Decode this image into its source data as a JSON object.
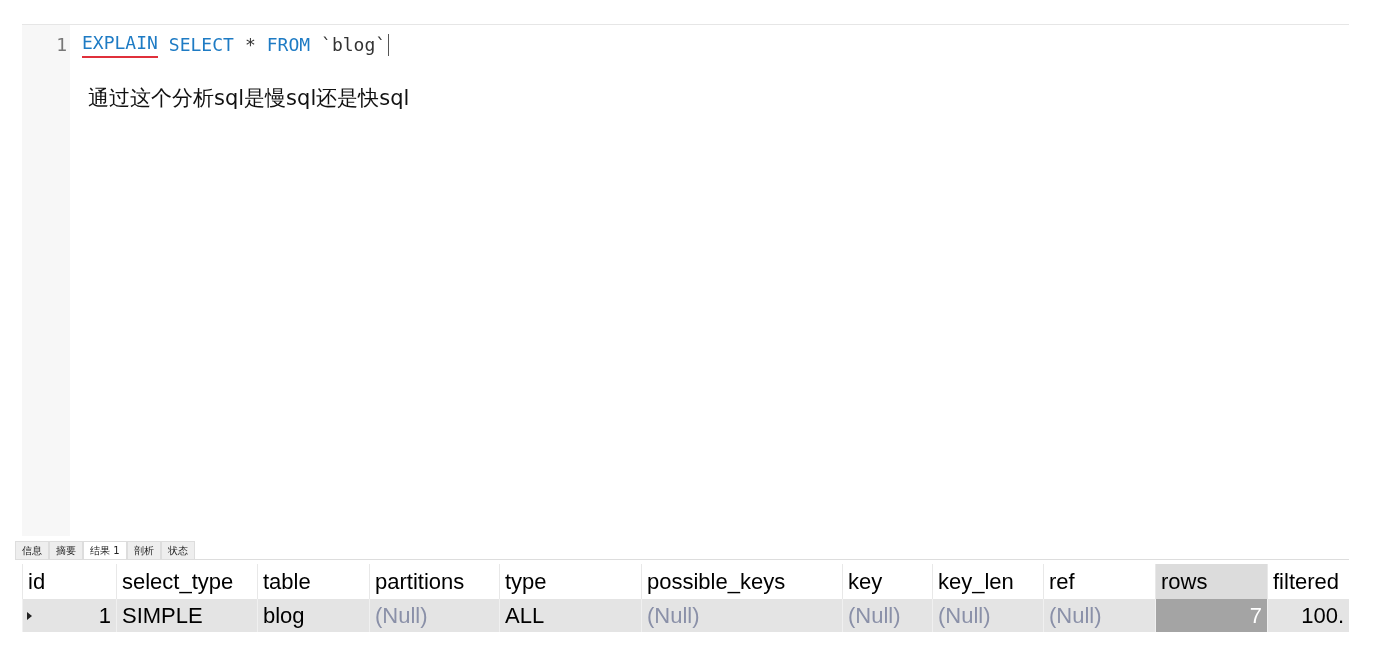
{
  "editor": {
    "lines": [
      {
        "number": "1",
        "tokens": [
          {
            "text": "EXPLAIN",
            "kind": "keyword",
            "underlined": true
          },
          {
            "text": "SELECT",
            "kind": "keyword",
            "underlined": false
          },
          {
            "text": "*",
            "kind": "plain",
            "underlined": false
          },
          {
            "text": "FROM",
            "kind": "keyword",
            "underlined": false
          },
          {
            "text": "`blog`",
            "kind": "plain",
            "underlined": false
          }
        ]
      }
    ],
    "annotation": "通过这个分析sql是慢sql还是快sql"
  },
  "tabs": [
    {
      "label": "信息",
      "selected": false
    },
    {
      "label": "摘要",
      "selected": false
    },
    {
      "label": "结果 1",
      "selected": true
    },
    {
      "label": "剖析",
      "selected": false
    },
    {
      "label": "状态",
      "selected": false
    }
  ],
  "table": {
    "columns": [
      {
        "label": "id",
        "selected": false
      },
      {
        "label": "select_type",
        "selected": false
      },
      {
        "label": "table",
        "selected": false
      },
      {
        "label": "partitions",
        "selected": false
      },
      {
        "label": "type",
        "selected": false
      },
      {
        "label": "possible_keys",
        "selected": false
      },
      {
        "label": "key",
        "selected": false
      },
      {
        "label": "key_len",
        "selected": false
      },
      {
        "label": "ref",
        "selected": false
      },
      {
        "label": "rows",
        "selected": true
      },
      {
        "label": "filtered",
        "selected": false
      }
    ],
    "rows": [
      {
        "current": true,
        "cells": [
          {
            "text": "1",
            "kind": "number"
          },
          {
            "text": "SIMPLE",
            "kind": "text"
          },
          {
            "text": "blog",
            "kind": "text"
          },
          {
            "text": "(Null)",
            "kind": "null"
          },
          {
            "text": "ALL",
            "kind": "text"
          },
          {
            "text": "(Null)",
            "kind": "null"
          },
          {
            "text": "(Null)",
            "kind": "null"
          },
          {
            "text": "(Null)",
            "kind": "null"
          },
          {
            "text": "(Null)",
            "kind": "null"
          },
          {
            "text": "7",
            "kind": "number"
          },
          {
            "text": "100.",
            "kind": "number"
          }
        ]
      }
    ]
  }
}
